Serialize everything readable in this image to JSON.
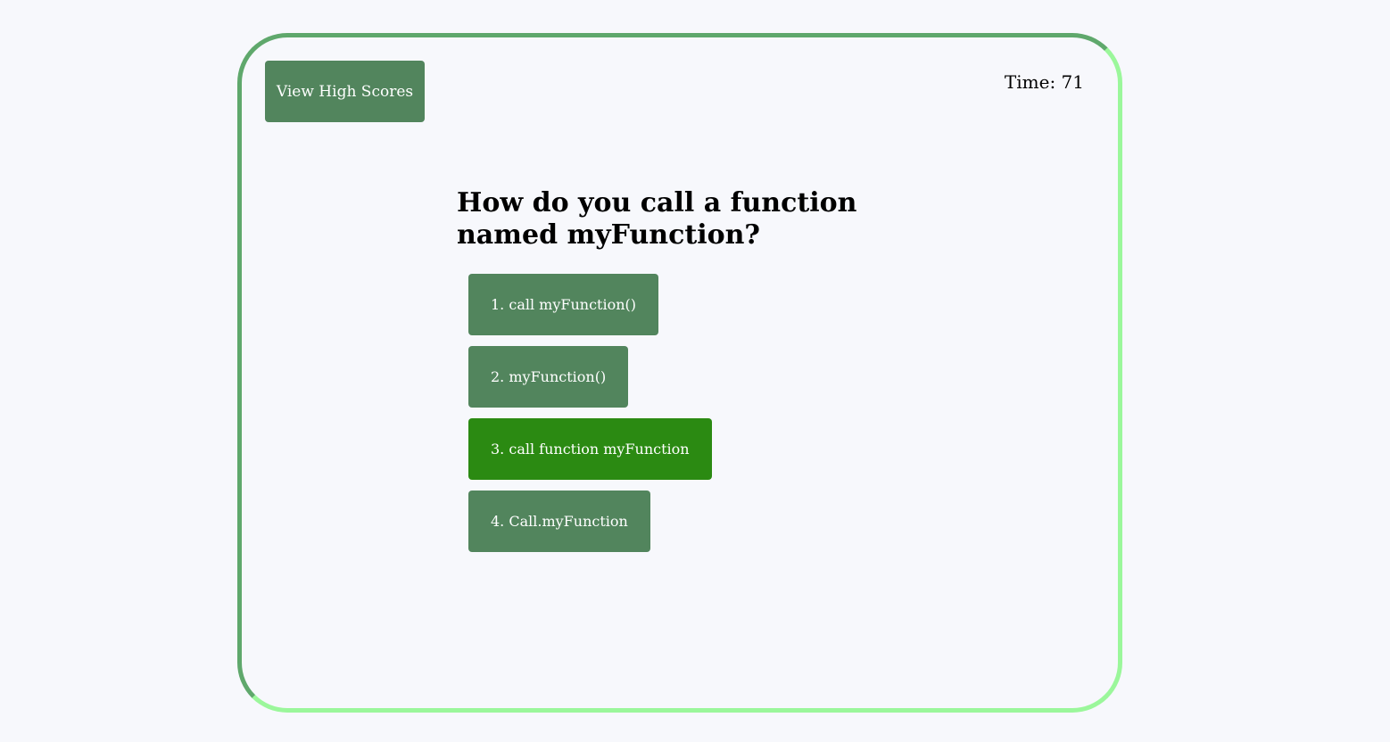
{
  "header": {
    "high_scores_label": "View High Scores",
    "timer_label": "Time:",
    "timer_value": "71"
  },
  "question": {
    "text": "How do you call a function named myFunction?"
  },
  "answers": [
    {
      "label": "1. call myFunction()"
    },
    {
      "label": "2. myFunction()"
    },
    {
      "label": "3. call function myFunction"
    },
    {
      "label": "4. Call.myFunction"
    }
  ],
  "colors": {
    "button": "#52855d",
    "button_hover": "#2b8a12",
    "border_dark": "#5fa86c",
    "border_light": "#9bf79b",
    "background": "#f7f8fc"
  }
}
